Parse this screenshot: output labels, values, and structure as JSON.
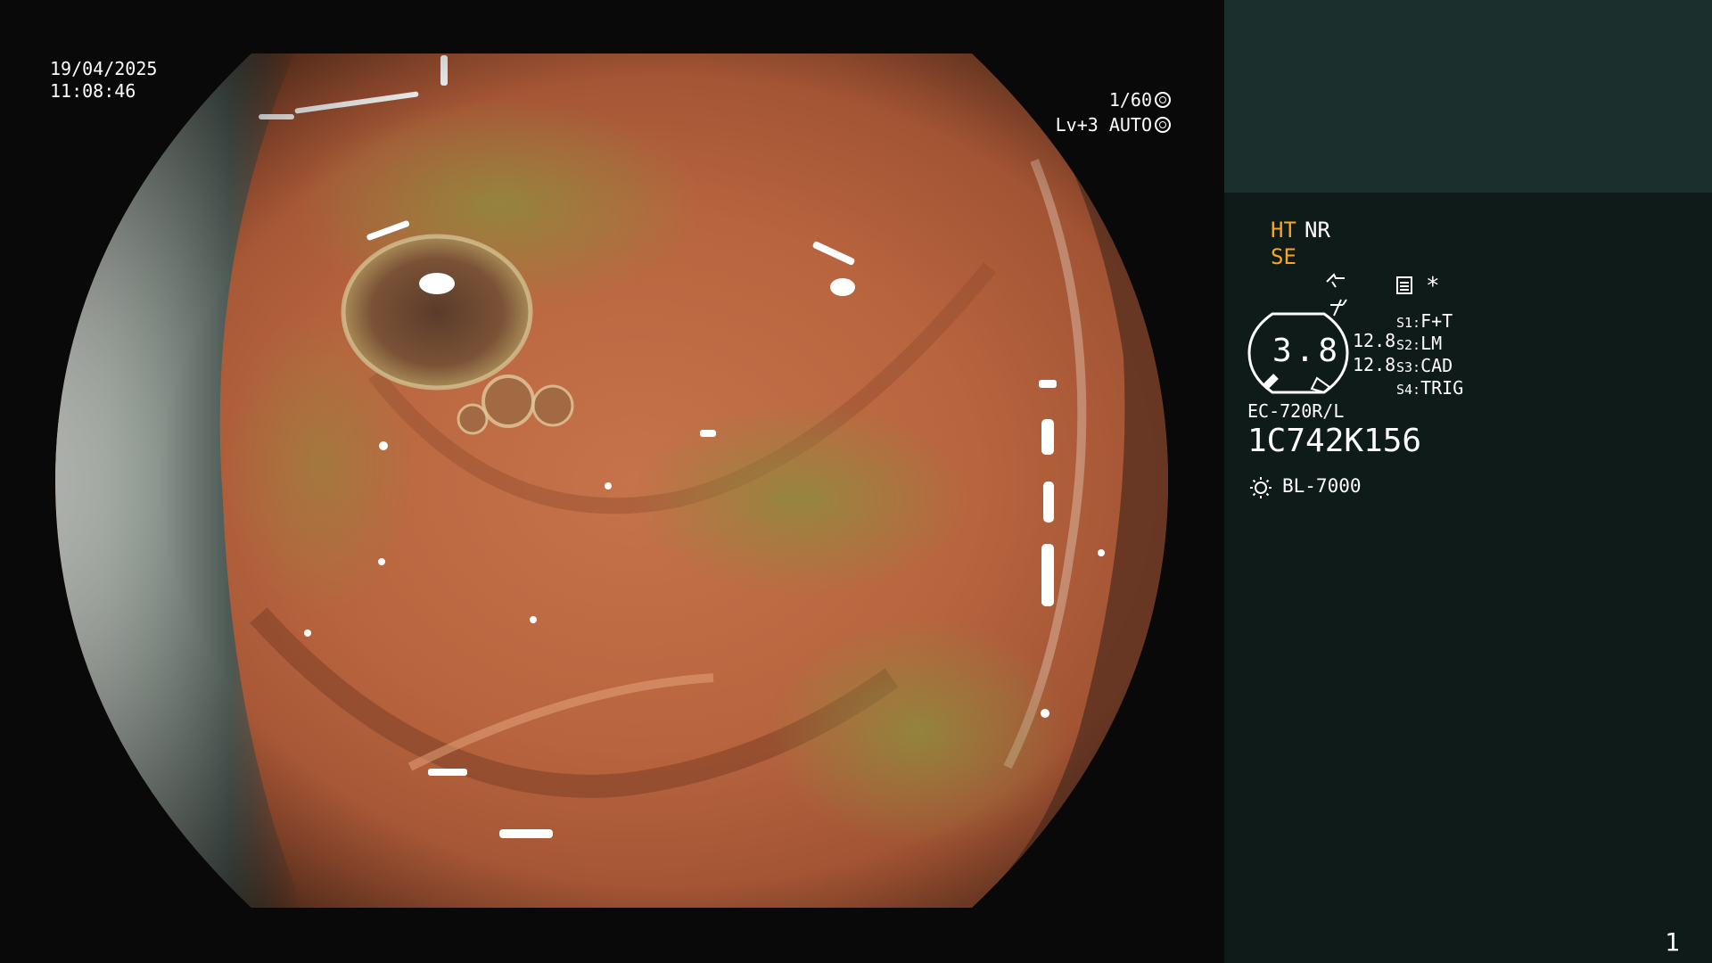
{
  "overlay": {
    "date": "19/04/2025",
    "time": "11:08:46",
    "shutter": "1/60",
    "shutter_icon": "aperture-icon",
    "gain": "Lv+3 AUTO",
    "gain_icon": "iris-icon"
  },
  "panel": {
    "modes": {
      "ht": "HT",
      "nr": "NR",
      "se": "SE",
      "enhancement_icon": "enhancement-icon",
      "freeze_icon": "freeze-icon",
      "memo_icon": "memo-icon",
      "asterisk": "*"
    },
    "gauge": {
      "value": "3.8",
      "readout_1": "12.8",
      "readout_2": "12.8"
    },
    "switches": [
      {
        "key": "S1:",
        "value": "F+T"
      },
      {
        "key": "S2:",
        "value": "LM"
      },
      {
        "key": "S3:",
        "value": "CAD"
      },
      {
        "key": "S4:",
        "value": "TRIG"
      }
    ],
    "scope_model": "EC-720R/L",
    "scope_serial": "1C742K156",
    "light_icon": "sun-icon",
    "light_source": "BL-7000",
    "page_number": "1"
  },
  "colors": {
    "background": "#090909",
    "panel": "#0f1b19",
    "panel_header": "#1b2f2d",
    "highlight": "#f6a623",
    "text": "#ffffff"
  }
}
